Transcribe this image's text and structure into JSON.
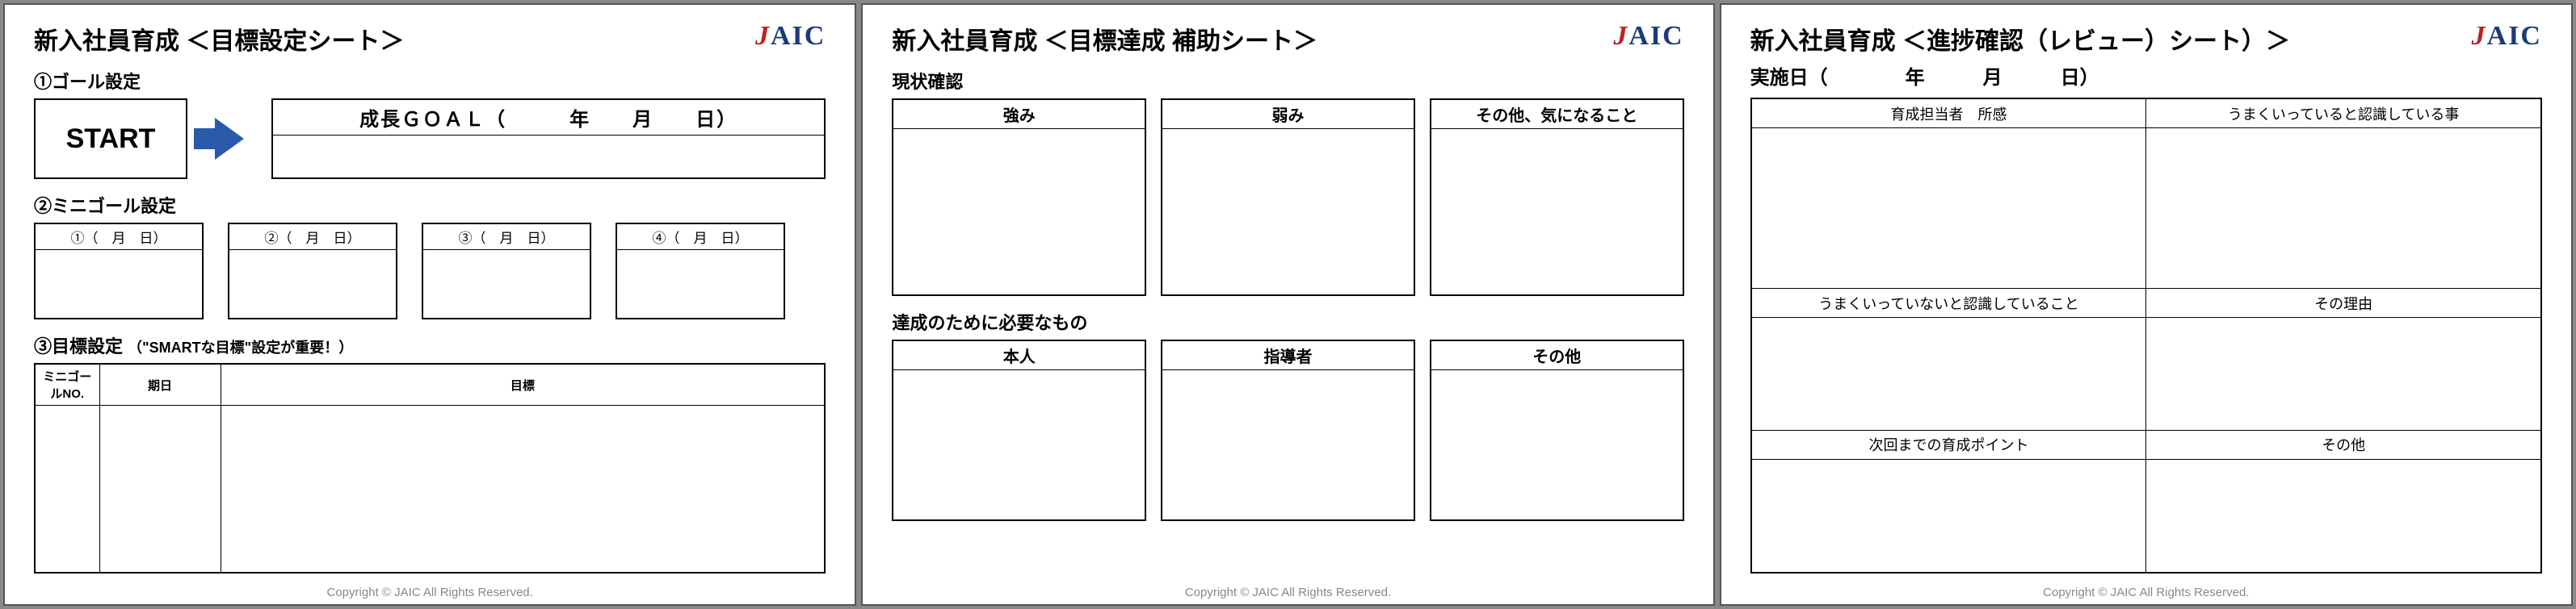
{
  "copyright": "Copyright © JAIC All Rights Reserved.",
  "logo": {
    "j": "J",
    "rest": "AIC"
  },
  "sheet1": {
    "title": "新入社員育成 ＜目標設定シート＞",
    "sec1_label": "①ゴール設定",
    "start": "START",
    "goal_header": "成長ＧＯＡＬ（　　　年　　月　　日）",
    "sec2_label": "②ミニゴール設定",
    "mini": [
      "①（　月　日）",
      "②（　月　日）",
      "③（　月　日）",
      "④（　月　日）"
    ],
    "sec3_label": "③目標設定",
    "sec3_note": "（\"SMARTな目標\"設定が重要！）",
    "table": {
      "col_no": "ミニゴールNO.",
      "col_date": "期日",
      "col_goal": "目標"
    }
  },
  "sheet2": {
    "title": "新入社員育成 ＜目標達成 補助シート＞",
    "sec1_label": "現状確認",
    "boxes1": [
      "強み",
      "弱み",
      "その他、気になること"
    ],
    "sec2_label": "達成のために必要なもの",
    "boxes2": [
      "本人",
      "指導者",
      "その他"
    ]
  },
  "sheet3": {
    "title": "新入社員育成 ＜進捗確認（レビュー）シート）＞",
    "date_label": "実施日（　　　　年　　　月　　　日）",
    "cells": [
      "育成担当者　所感",
      "うまくいっていると認識している事",
      "うまくいっていないと認識していること",
      "その理由",
      "次回までの育成ポイント",
      "その他"
    ]
  }
}
